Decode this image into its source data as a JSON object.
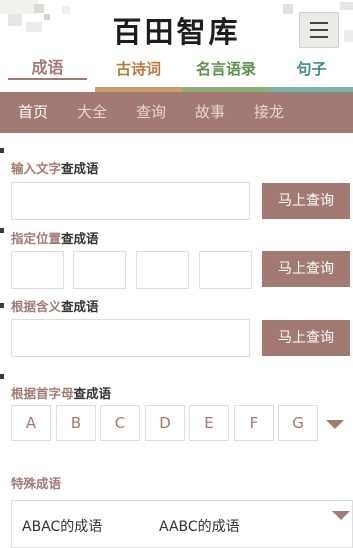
{
  "header": {
    "logo": "百田智库",
    "menu_icon": "hamburger-menu-icon"
  },
  "categories": [
    {
      "label": "成语",
      "color": "#a37a73",
      "active": true
    },
    {
      "label": "古诗词",
      "color": "#b87a3c"
    },
    {
      "label": "名言语录",
      "color": "#5f8f4e"
    },
    {
      "label": "句子",
      "color": "#3d8f8c"
    }
  ],
  "subnav": [
    "首页",
    "大全",
    "查询",
    "故事",
    "接龙"
  ],
  "search_text": {
    "label_hl": "输入文字",
    "label_dk": "查成语",
    "input_value": "",
    "button": "马上查询"
  },
  "search_position": {
    "label_hl": "指定位置",
    "label_dk": "查成语",
    "inputs": [
      "",
      "",
      "",
      ""
    ],
    "button": "马上查询"
  },
  "search_meaning": {
    "label_hl": "根据含义",
    "label_dk": "查成语",
    "input_value": "",
    "button": "马上查询"
  },
  "search_initial": {
    "label_hl": "根据首字母",
    "label_dk": "查成语",
    "letters": [
      "A",
      "B",
      "C",
      "D",
      "E",
      "F",
      "G"
    ],
    "expand_icon": "caret-down-icon"
  },
  "special": {
    "label": "特殊成语",
    "items": [
      "ABAC的成语",
      "AABC的成语"
    ],
    "expand_icon": "caret-down-icon"
  },
  "colors": {
    "accent": "#a37a73",
    "light_bg": "#ecebe7"
  }
}
